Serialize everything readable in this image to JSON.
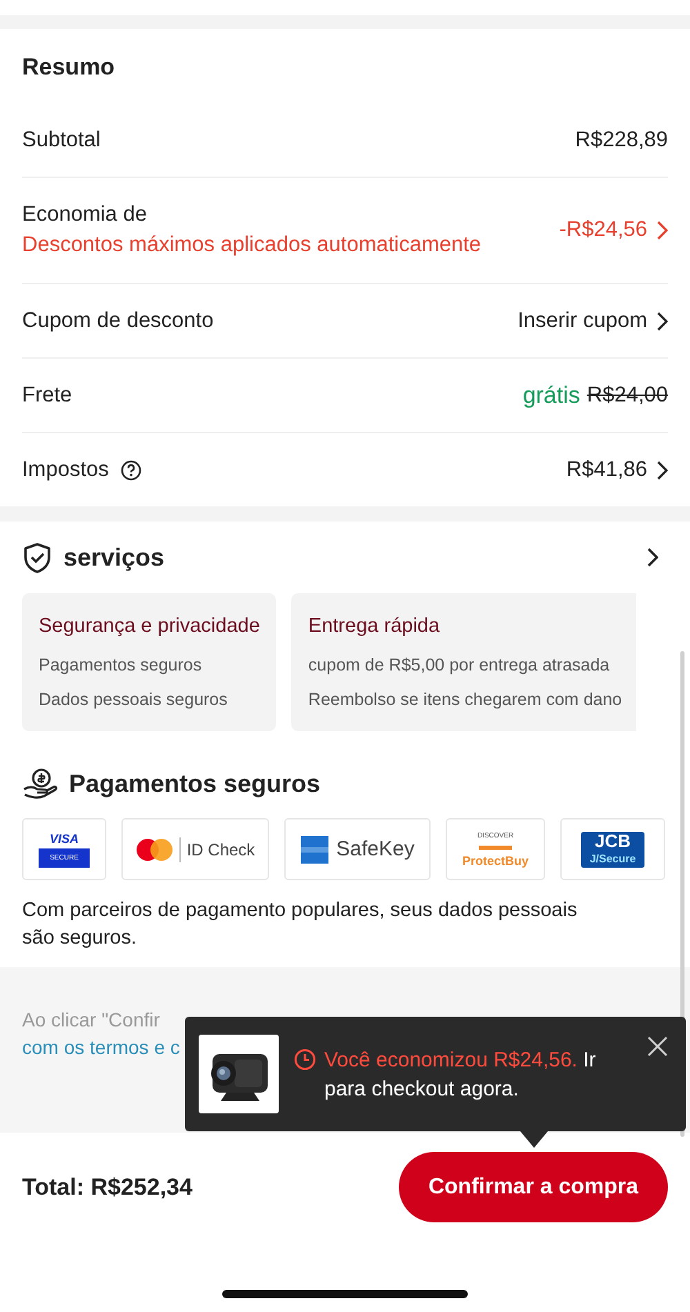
{
  "summary": {
    "title": "Resumo",
    "rows": [
      {
        "kind": "plain",
        "label": "Subtotal",
        "value": "R$228,89"
      },
      {
        "kind": "savings",
        "label": "Economia de",
        "sublabel": "Descontos máximos aplicados automaticamente",
        "value": "-R$24,56"
      },
      {
        "kind": "link",
        "label": "Cupom de desconto",
        "value": "Inserir cupom"
      },
      {
        "kind": "shipping",
        "label": "Frete",
        "value": "grátis",
        "old_value": "R$24,00"
      },
      {
        "kind": "info",
        "label": "Impostos",
        "value": "R$41,86"
      }
    ]
  },
  "services": {
    "title": "serviços",
    "cards": [
      {
        "title": "Segurança e privacidade",
        "lines": [
          "Pagamentos seguros",
          "Dados pessoais seguros"
        ]
      },
      {
        "title": "Entrega rápida",
        "lines": [
          "cupom de R$5,00 por entrega atrasada",
          "Reembolso se itens chegarem com dano"
        ]
      }
    ]
  },
  "payments": {
    "title": "Pagamentos seguros",
    "logos": [
      {
        "kind": "visa",
        "texts": [
          "VISA",
          "SECURE"
        ]
      },
      {
        "kind": "mastercard",
        "texts": [
          "ID Check"
        ]
      },
      {
        "kind": "amex",
        "texts": [
          "SafeKey"
        ]
      },
      {
        "kind": "discover",
        "texts": [
          "DISCOVER",
          "ProtectBuy"
        ]
      },
      {
        "kind": "jcb",
        "texts": [
          "JCB",
          "J/Secure"
        ]
      }
    ],
    "note": "Com parceiros de pagamento populares, seus dados pessoais são seguros."
  },
  "terms": {
    "text": "Ao clicar \"Confir",
    "link": "com os termos e c"
  },
  "toast": {
    "highlight": "Você economizou R$24,56.",
    "text": "Ir para checkout agora."
  },
  "footer": {
    "total": "Total: R$252,34",
    "button": "Confirmar a compra"
  }
}
